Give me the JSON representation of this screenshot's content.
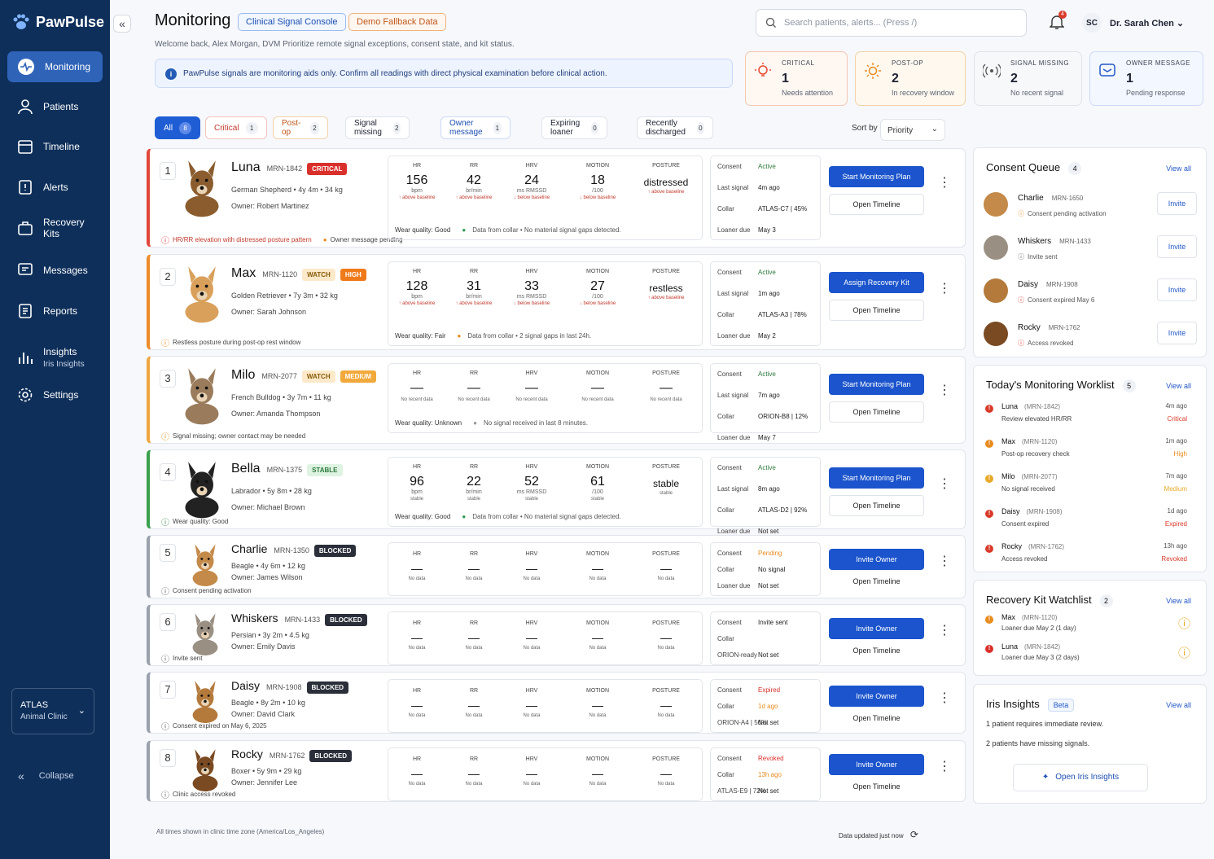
{
  "app": {
    "name": "PawPulse"
  },
  "nav": [
    {
      "label": "Monitoring"
    },
    {
      "label": "Patients"
    },
    {
      "label": "Timeline"
    },
    {
      "label": "Alerts"
    },
    {
      "label": "Recovery Kits"
    },
    {
      "label": "Messages"
    },
    {
      "label": "Reports"
    },
    {
      "label": "Insights",
      "sub": "Iris Insights"
    },
    {
      "label": "Settings"
    }
  ],
  "org": {
    "name": "ATLAS",
    "sub": "Animal Clinic"
  },
  "collapse_label": "Collapse",
  "header": {
    "title": "Monitoring",
    "pill1": "Clinical Signal Console",
    "pill2": "Demo Fallback Data",
    "welcome": "Welcome back, Alex Morgan, DVM   Prioritize remote signal exceptions, consent state, and kit status.",
    "info": "PawPulse signals are monitoring aids only. Confirm all readings with direct physical examination before clinical action.",
    "search_placeholder": "Search patients, alerts... (Press /)",
    "notif_count": "4",
    "user_initials": "SC",
    "user_name": "Dr. Sarah Chen"
  },
  "stats": [
    {
      "label": "Critical",
      "value": "1",
      "sub": "Needs attention",
      "color": "#e8492f"
    },
    {
      "label": "Post-op",
      "value": "2",
      "sub": "In recovery window",
      "color": "#e88b1f"
    },
    {
      "label": "Signal missing",
      "value": "2",
      "sub": "No recent signal",
      "color": "#555"
    },
    {
      "label": "Owner message",
      "value": "1",
      "sub": "Pending response",
      "color": "#2358c7"
    }
  ],
  "filters": [
    {
      "label": "All",
      "count": "8"
    },
    {
      "label": "Critical",
      "count": "1"
    },
    {
      "label": "Post-op",
      "count": "2"
    },
    {
      "label": "Signal missing",
      "count": "2"
    },
    {
      "label": "Owner message",
      "count": "1"
    },
    {
      "label": "Expiring loaner",
      "count": "0"
    },
    {
      "label": "Recently discharged",
      "count": "0"
    }
  ],
  "sort": {
    "label": "Sort by",
    "value": "Priority"
  },
  "patients": [
    {
      "rank": "1",
      "name": "Luna",
      "mrn": "MRN-1842",
      "tags": [
        "CRITICAL"
      ],
      "detail": "German Shepherd • 4y 4m • 34 kg",
      "owner": "Owner: Robert Martinez",
      "note": "HR/RR elevation with distressed posture pattern",
      "note2": "Owner message pending",
      "vitals": [
        [
          "HR",
          "156",
          "bpm",
          "↑ above baseline"
        ],
        [
          "RR",
          "42",
          "br/min",
          "↑ above baseline"
        ],
        [
          "HRV",
          "24",
          "ms RMSSD",
          "↓ below baseline"
        ],
        [
          "MOTION",
          "18",
          "/100",
          "↓ below baseline"
        ],
        [
          "POSTURE",
          "distressed",
          "",
          "↑ above baseline"
        ]
      ],
      "wear": "Wear quality: Good",
      "wearnote": "Data from collar • No material signal gaps detected.",
      "meta": [
        [
          "Consent",
          "Active"
        ],
        [
          "Last signal",
          "4m ago"
        ],
        [
          "Collar",
          "ATLAS-C7  |  45%"
        ],
        [
          "Loaner due",
          "May 3"
        ]
      ],
      "primary": "Start Monitoring Plan",
      "secondary": "Open Timeline"
    },
    {
      "rank": "2",
      "name": "Max",
      "mrn": "MRN-1120",
      "tags": [
        "WATCH",
        "HIGH"
      ],
      "detail": "Golden Retriever • 7y 3m • 32 kg",
      "owner": "Owner: Sarah Johnson",
      "note": "Restless posture during post-op rest window",
      "note2": "",
      "vitals": [
        [
          "HR",
          "128",
          "bpm",
          "↑ above baseline"
        ],
        [
          "RR",
          "31",
          "br/min",
          "↑ above baseline"
        ],
        [
          "HRV",
          "33",
          "ms RMSSD",
          "↓ below baseline"
        ],
        [
          "MOTION",
          "27",
          "/100",
          "↓ below baseline"
        ],
        [
          "POSTURE",
          "restless",
          "",
          "↑ above baseline"
        ]
      ],
      "wear": "Wear quality: Fair",
      "wearnote": "Data from collar • 2 signal gaps in last 24h.",
      "meta": [
        [
          "Consent",
          "Active"
        ],
        [
          "Last signal",
          "1m ago"
        ],
        [
          "Collar",
          "ATLAS-A3  |  78%"
        ],
        [
          "Loaner due",
          "May 2"
        ]
      ],
      "primary": "Assign Recovery Kit",
      "secondary": "Open Timeline"
    },
    {
      "rank": "3",
      "name": "Milo",
      "mrn": "MRN-2077",
      "tags": [
        "WATCH",
        "MEDIUM"
      ],
      "detail": "French Bulldog • 3y 7m • 11 kg",
      "owner": "Owner: Amanda Thompson",
      "note": "Signal missing; owner contact may be needed",
      "note2": "",
      "vitals": [
        [
          "HR",
          "—",
          "",
          "No recent data"
        ],
        [
          "RR",
          "—",
          "",
          "No recent data"
        ],
        [
          "HRV",
          "—",
          "",
          "No recent data"
        ],
        [
          "MOTION",
          "—",
          "",
          "No recent data"
        ],
        [
          "POSTURE",
          "—",
          "",
          "No recent data"
        ]
      ],
      "wear": "Wear quality: Unknown",
      "wearnote": "No signal received in last 8 minutes.",
      "meta": [
        [
          "Consent",
          "Active"
        ],
        [
          "Last signal",
          "7m ago"
        ],
        [
          "Collar",
          "ORION-B8  |  12%"
        ],
        [
          "Loaner due",
          "May 7"
        ]
      ],
      "primary": "Start Monitoring Plan",
      "secondary": "Open Timeline"
    },
    {
      "rank": "4",
      "name": "Bella",
      "mrn": "MRN-1375",
      "tags": [
        "STABLE"
      ],
      "detail": "Labrador • 5y 8m • 28 kg",
      "owner": "Owner: Michael Brown",
      "note": "Wear quality: Good",
      "note2": "",
      "vitals": [
        [
          "HR",
          "96",
          "bpm",
          "stable"
        ],
        [
          "RR",
          "22",
          "br/min",
          "stable"
        ],
        [
          "HRV",
          "52",
          "ms RMSSD",
          "stable"
        ],
        [
          "MOTION",
          "61",
          "/100",
          "stable"
        ],
        [
          "POSTURE",
          "stable",
          "",
          "stable"
        ]
      ],
      "wear": "Wear quality: Good",
      "wearnote": "Data from collar • No material signal gaps detected.",
      "meta": [
        [
          "Consent",
          "Active"
        ],
        [
          "Last signal",
          "8m ago"
        ],
        [
          "Collar",
          "ATLAS-D2  |  92%"
        ],
        [
          "Loaner due",
          "Not set"
        ]
      ],
      "primary": "Start Monitoring Plan",
      "secondary": "Open Timeline"
    },
    {
      "rank": "5",
      "name": "Charlie",
      "mrn": "MRN-1350",
      "tags": [
        "BLOCKED"
      ],
      "detail": "Beagle • 4y 6m • 12 kg",
      "owner": "Owner: James Wilson",
      "note": "Consent pending activation",
      "note2": "",
      "vitals": [
        [
          "HR",
          "—",
          "",
          "No data"
        ],
        [
          "RR",
          "—",
          "",
          "No data"
        ],
        [
          "HRV",
          "—",
          "",
          "No data"
        ],
        [
          "MOTION",
          "—",
          "",
          "No data"
        ],
        [
          "POSTURE",
          "—",
          "",
          "No data"
        ]
      ],
      "wear": "",
      "wearnote": "",
      "meta": [
        [
          "Consent",
          "Pending"
        ],
        [
          "Collar",
          "No signal"
        ],
        [
          "Loaner due",
          "Not set"
        ]
      ],
      "primary": "Invite Owner",
      "secondary": "Open Timeline"
    },
    {
      "rank": "6",
      "name": "Whiskers",
      "mrn": "MRN-1433",
      "tags": [
        "BLOCKED"
      ],
      "detail": "Persian • 3y 2m • 4.5 kg",
      "owner": "Owner: Emily Davis",
      "note": "Invite sent",
      "note2": "",
      "vitals": [
        [
          "HR",
          "—",
          "",
          "No data"
        ],
        [
          "RR",
          "—",
          "",
          "No data"
        ],
        [
          "HRV",
          "—",
          "",
          "No data"
        ],
        [
          "MOTION",
          "—",
          "",
          "No data"
        ],
        [
          "POSTURE",
          "—",
          "",
          "No data"
        ]
      ],
      "wear": "",
      "wearnote": "",
      "meta": [
        [
          "Consent",
          "Invite sent"
        ],
        [
          "Collar",
          ""
        ],
        [
          "ORION-ready",
          "Not set"
        ]
      ],
      "primary": "Invite Owner",
      "secondary": "Open Timeline"
    },
    {
      "rank": "7",
      "name": "Daisy",
      "mrn": "MRN-1908",
      "tags": [
        "BLOCKED"
      ],
      "detail": "Beagle • 8y 2m • 10 kg",
      "owner": "Owner: David Clark",
      "note": "Consent expired on May 6, 2025",
      "note2": "",
      "vitals": [
        [
          "HR",
          "—",
          "",
          "No data"
        ],
        [
          "RR",
          "—",
          "",
          "No data"
        ],
        [
          "HRV",
          "—",
          "",
          "No data"
        ],
        [
          "MOTION",
          "—",
          "",
          "No data"
        ],
        [
          "POSTURE",
          "—",
          "",
          "No data"
        ]
      ],
      "wear": "",
      "wearnote": "",
      "meta": [
        [
          "Consent",
          "Expired"
        ],
        [
          "Collar",
          "1d ago"
        ],
        [
          "ORION-A4  |  56%",
          "Not set"
        ]
      ],
      "primary": "Invite Owner",
      "secondary": "Open Timeline"
    },
    {
      "rank": "8",
      "name": "Rocky",
      "mrn": "MRN-1762",
      "tags": [
        "BLOCKED"
      ],
      "detail": "Boxer • 5y 9m • 29 kg",
      "owner": "Owner: Jennifer Lee",
      "note": "Clinic access revoked",
      "note2": "",
      "vitals": [
        [
          "HR",
          "—",
          "",
          "No data"
        ],
        [
          "RR",
          "—",
          "",
          "No data"
        ],
        [
          "HRV",
          "—",
          "",
          "No data"
        ],
        [
          "MOTION",
          "—",
          "",
          "No data"
        ],
        [
          "POSTURE",
          "—",
          "",
          "No data"
        ]
      ],
      "wear": "",
      "wearnote": "",
      "meta": [
        [
          "Consent",
          "Revoked"
        ],
        [
          "Collar",
          "13h ago"
        ],
        [
          "ATLAS-E9  |  72%",
          "Not set"
        ]
      ],
      "primary": "Invite Owner",
      "secondary": "Open Timeline"
    }
  ],
  "consent_queue": {
    "title": "Consent Queue",
    "count": "4",
    "view_all": "View all",
    "items": [
      {
        "name": "Charlie",
        "mrn": "MRN-1650",
        "sub": "Consent pending activation",
        "action": "Invite"
      },
      {
        "name": "Whiskers",
        "mrn": "MRN-1433",
        "sub": "Invite sent",
        "action": "Invite"
      },
      {
        "name": "Daisy",
        "mrn": "MRN-1908",
        "sub": "Consent expired May 6",
        "action": "Invite"
      },
      {
        "name": "Rocky",
        "mrn": "MRN-1762",
        "sub": "Access revoked",
        "action": "Invite"
      }
    ]
  },
  "worklist": {
    "title": "Today's Monitoring Worklist",
    "count": "5",
    "view_all": "View all",
    "items": [
      {
        "name": "Luna",
        "mrn": "(MRN-1842)",
        "sub": "Review elevated HR/RR",
        "time": "4m ago",
        "sev": "Critical",
        "color": "#d93b2b"
      },
      {
        "name": "Max",
        "mrn": "(MRN-1120)",
        "sub": "Post-op recovery check",
        "time": "1m ago",
        "sev": "High",
        "color": "#e88b1f"
      },
      {
        "name": "Milo",
        "mrn": "(MRN-2077)",
        "sub": "No signal received",
        "time": "7m ago",
        "sev": "Medium",
        "color": "#e8a92a"
      },
      {
        "name": "Daisy",
        "mrn": "(MRN-1908)",
        "sub": "Consent expired",
        "time": "1d ago",
        "sev": "Expired",
        "color": "#d93b2b"
      },
      {
        "name": "Rocky",
        "mrn": "(MRN-1762)",
        "sub": "Access revoked",
        "time": "13h ago",
        "sev": "Revoked",
        "color": "#d93b2b"
      }
    ]
  },
  "kits": {
    "title": "Recovery Kit Watchlist",
    "count": "2",
    "view_all": "View all",
    "items": [
      {
        "name": "Max",
        "mrn": "(MRN-1120)",
        "sub": "Loaner due May 2 (1 day)"
      },
      {
        "name": "Luna",
        "mrn": "(MRN-1842)",
        "sub": "Loaner due May 3 (2 days)"
      }
    ]
  },
  "iris": {
    "title": "Iris Insights",
    "badge": "Beta",
    "view_all": "View all",
    "line1": "1  patient requires immediate review.",
    "line2": "2  patients have missing signals.",
    "button": "Open Iris Insights"
  },
  "footer": {
    "left": "All times shown in clinic time zone (America/Los_Angeles)",
    "right": "Data updated just now"
  }
}
